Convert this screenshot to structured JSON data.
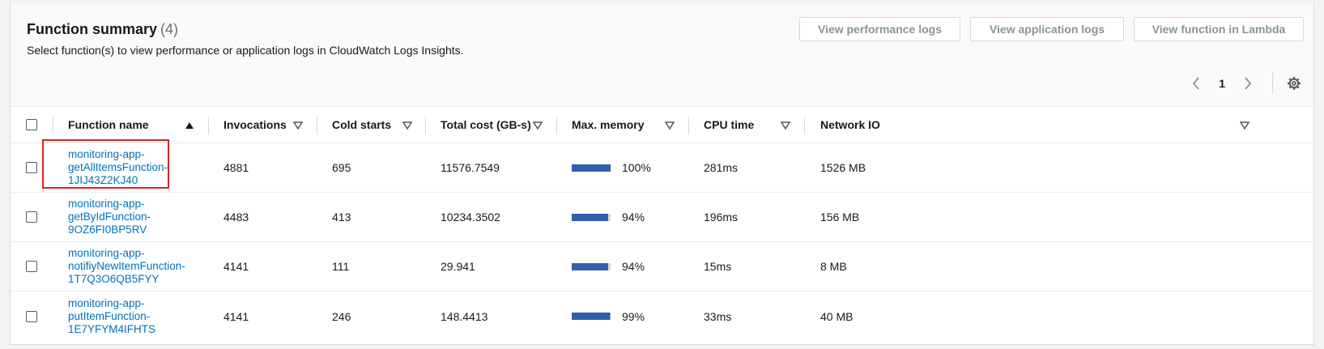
{
  "header": {
    "title": "Function summary",
    "count": "(4)",
    "subtitle": "Select function(s) to view performance or application logs in CloudWatch Logs Insights.",
    "buttons": {
      "performance_logs": "View performance logs",
      "application_logs": "View application logs",
      "view_in_lambda": "View function in Lambda"
    }
  },
  "pagination": {
    "current_page": "1"
  },
  "table": {
    "columns": {
      "function_name": "Function name",
      "invocations": "Invocations",
      "cold_starts": "Cold starts",
      "total_cost": "Total cost (GB-s)",
      "max_memory": "Max. memory",
      "cpu_time": "CPU time",
      "network_io": "Network IO"
    },
    "rows": [
      {
        "name_lines": [
          "monitoring-app-",
          "getAllItemsFunction-",
          "1JIJ43Z2KJ40"
        ],
        "invocations": "4881",
        "cold_starts": "695",
        "total_cost": "11576.7549",
        "max_memory": "100%",
        "max_memory_fraction": 1.0,
        "cpu_time": "281ms",
        "network_io": "1526 MB"
      },
      {
        "name_lines": [
          "monitoring-app-",
          "getByIdFunction-",
          "9OZ6FI0BP5RV"
        ],
        "invocations": "4483",
        "cold_starts": "413",
        "total_cost": "10234.3502",
        "max_memory": "94%",
        "max_memory_fraction": 0.94,
        "cpu_time": "196ms",
        "network_io": "156 MB"
      },
      {
        "name_lines": [
          "monitoring-app-",
          "notifiyNewItemFunction-",
          "1T7Q3O6QB5FYY"
        ],
        "invocations": "4141",
        "cold_starts": "111",
        "total_cost": "29.941",
        "max_memory": "94%",
        "max_memory_fraction": 0.94,
        "cpu_time": "15ms",
        "network_io": "8 MB"
      },
      {
        "name_lines": [
          "monitoring-app-",
          "putItemFunction-",
          "1E7YFYM4IFHTS"
        ],
        "invocations": "4141",
        "cold_starts": "246",
        "total_cost": "148.4413",
        "max_memory": "99%",
        "max_memory_fraction": 0.99,
        "cpu_time": "33ms",
        "network_io": "40 MB"
      }
    ]
  },
  "icons": {
    "sort_ascending": "triangle-up-icon",
    "sort_unsorted": "triangle-down-icon",
    "prev_page": "chevron-left-icon",
    "next_page": "chevron-right-icon",
    "settings": "gear-icon"
  },
  "colors": {
    "link": "#0073bb",
    "memory_bar": "#2f5fb0",
    "highlight": "#e02020"
  }
}
